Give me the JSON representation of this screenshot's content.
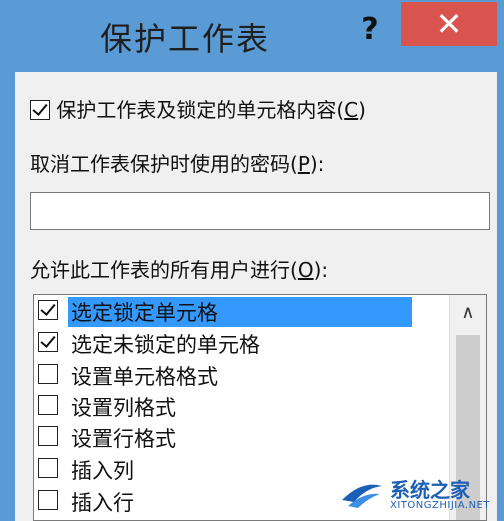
{
  "dialog": {
    "title": "保护工作表",
    "help_label": "?",
    "close_label": "✕"
  },
  "protect": {
    "checked": true,
    "label": "保护工作表及锁定的单元格内容",
    "hotkey_open": "(",
    "hotkey": "C",
    "hotkey_close": ")"
  },
  "password": {
    "label": "取消工作表保护时使用的密码",
    "hotkey_open": "(",
    "hotkey": "P",
    "hotkey_close": "):",
    "value": ""
  },
  "allow": {
    "label": "允许此工作表的所有用户进行",
    "hotkey_open": "(",
    "hotkey": "O",
    "hotkey_close": "):",
    "items": [
      {
        "label": "选定锁定单元格",
        "checked": true,
        "selected": true
      },
      {
        "label": "选定未锁定的单元格",
        "checked": true,
        "selected": false
      },
      {
        "label": "设置单元格格式",
        "checked": false,
        "selected": false
      },
      {
        "label": "设置列格式",
        "checked": false,
        "selected": false
      },
      {
        "label": "设置行格式",
        "checked": false,
        "selected": false
      },
      {
        "label": "插入列",
        "checked": false,
        "selected": false
      },
      {
        "label": "插入行",
        "checked": false,
        "selected": false
      }
    ]
  },
  "scrollbar": {
    "up_arrow": "∧"
  },
  "watermark": {
    "name": "系统之家",
    "url": "XITONGZHIJIA.NET"
  }
}
